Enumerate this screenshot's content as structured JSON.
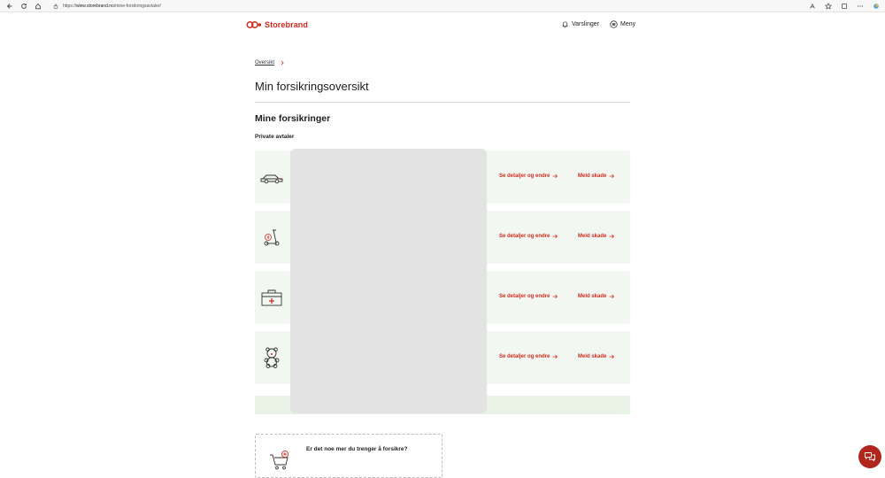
{
  "browser": {
    "url_prefix": "https://",
    "url_domain": "www.storebrand.no",
    "url_path": "/mine-forsikringsavtaler/"
  },
  "header": {
    "brand": "Storebrand",
    "notifications_label": "Varslinger",
    "menu_label": "Meny"
  },
  "breadcrumb": {
    "label": "Oversikt"
  },
  "page": {
    "title": "Min forsikringsoversikt",
    "section_title": "Mine forsikringer",
    "group_title": "Private avtaler"
  },
  "cards": [
    {
      "icon": "car-icon",
      "details_label": "Se detaljer og endre",
      "claim_label": "Meld skade"
    },
    {
      "icon": "electric-scooter-icon",
      "details_label": "Se detaljer og endre",
      "claim_label": "Meld skade"
    },
    {
      "icon": "first-aid-kit-icon",
      "details_label": "Se detaljer og endre",
      "claim_label": "Meld skade"
    },
    {
      "icon": "teddy-bear-icon",
      "details_label": "Se detaljer og endre",
      "claim_label": "Meld skade"
    }
  ],
  "promo": {
    "title": "Er det noe mer du trenger å forsikre?",
    "icon": "shopping-cart-add-icon"
  },
  "colors": {
    "brand_red": "#d32a1f",
    "card_bg": "#f3f7f1",
    "chat_bg": "#b0251d"
  }
}
